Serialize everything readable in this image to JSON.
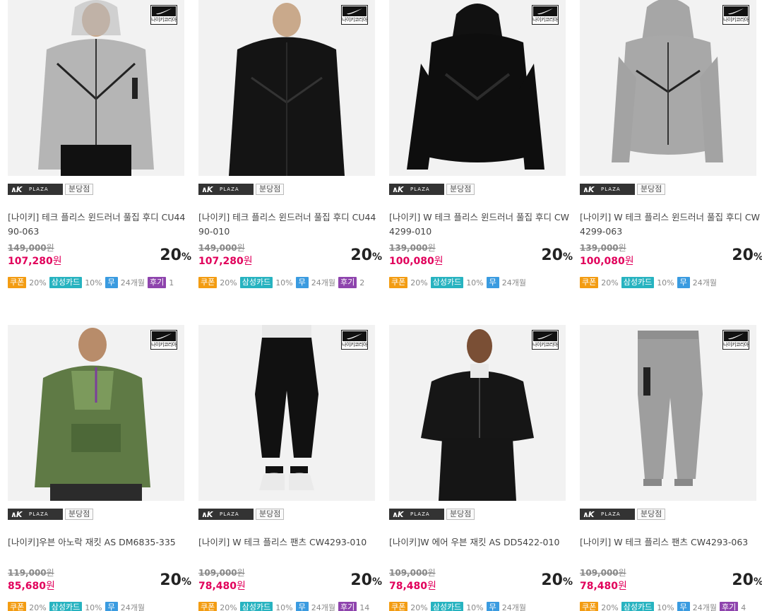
{
  "badge_text": "나이키코리아",
  "store_logo": "PLAZA",
  "products": [
    {
      "title": "[나이키] 테크 플리스 윈드러너 풀집 후디 CU4490-063",
      "original_price": "149,000",
      "sale_price": "107,280",
      "won": "원",
      "discount": "20",
      "pct": "%",
      "branch": "분당점",
      "coupon_label": "쿠폰",
      "coupon_value": "20%",
      "card_label": "삼성카드",
      "card_value": "10%",
      "free_label": "무",
      "months": "24개월",
      "review_label": "후기",
      "review_count": "1",
      "image": "gray-hoodie-man"
    },
    {
      "title": "[나이키] 테크 플리스 윈드러너 풀집 후디 CU4490-010",
      "original_price": "149,000",
      "sale_price": "107,280",
      "won": "원",
      "discount": "20",
      "pct": "%",
      "branch": "분당점",
      "coupon_label": "쿠폰",
      "coupon_value": "20%",
      "card_label": "삼성카드",
      "card_value": "10%",
      "free_label": "무",
      "months": "24개월",
      "review_label": "후기",
      "review_count": "2",
      "image": "black-hoodie-man"
    },
    {
      "title": "[나이키] W 테크 플리스 윈드러너 풀집 후디 CW4299-010",
      "original_price": "139,000",
      "sale_price": "100,080",
      "won": "원",
      "discount": "20",
      "pct": "%",
      "branch": "분당점",
      "coupon_label": "쿠폰",
      "coupon_value": "20%",
      "card_label": "삼성카드",
      "card_value": "10%",
      "free_label": "무",
      "months": "24개월",
      "review_label": "",
      "review_count": "",
      "image": "black-hoodie-product"
    },
    {
      "title": "[나이키] W 테크 플리스 윈드러너 풀집 후디 CW4299-063",
      "original_price": "139,000",
      "sale_price": "100,080",
      "won": "원",
      "discount": "20",
      "pct": "%",
      "branch": "분당점",
      "coupon_label": "쿠폰",
      "coupon_value": "20%",
      "card_label": "삼성카드",
      "card_value": "10%",
      "free_label": "무",
      "months": "24개월",
      "review_label": "",
      "review_count": "",
      "image": "gray-hoodie-product"
    },
    {
      "title": "[나이키]우븐 아노락 재킷 AS DM6835-335",
      "original_price": "119,000",
      "sale_price": "85,680",
      "won": "원",
      "discount": "20",
      "pct": "%",
      "branch": "분당점",
      "coupon_label": "쿠폰",
      "coupon_value": "20%",
      "card_label": "삼성카드",
      "card_value": "10%",
      "free_label": "무",
      "months": "24개월",
      "review_label": "",
      "review_count": "",
      "image": "green-anorak-man"
    },
    {
      "title": "[나이키] W 테크 플리스 팬츠 CW4293-010",
      "original_price": "109,000",
      "sale_price": "78,480",
      "won": "원",
      "discount": "20",
      "pct": "%",
      "branch": "분당점",
      "coupon_label": "쿠폰",
      "coupon_value": "20%",
      "card_label": "삼성카드",
      "card_value": "10%",
      "free_label": "무",
      "months": "24개월",
      "review_label": "후기",
      "review_count": "14",
      "image": "black-pants-woman"
    },
    {
      "title": "[나이키]W 에어 우븐 재킷 AS DD5422-010",
      "original_price": "109,000",
      "sale_price": "78,480",
      "won": "원",
      "discount": "20",
      "pct": "%",
      "branch": "분당점",
      "coupon_label": "쿠폰",
      "coupon_value": "20%",
      "card_label": "삼성카드",
      "card_value": "10%",
      "free_label": "무",
      "months": "24개월",
      "review_label": "",
      "review_count": "",
      "image": "black-jacket-woman"
    },
    {
      "title": "[나이키] W 테크 플리스 팬츠 CW4293-063",
      "original_price": "109,000",
      "sale_price": "78,480",
      "won": "원",
      "discount": "20",
      "pct": "%",
      "branch": "분당점",
      "coupon_label": "쿠폰",
      "coupon_value": "20%",
      "card_label": "삼성카드",
      "card_value": "10%",
      "free_label": "무",
      "months": "24개월",
      "review_label": "후기",
      "review_count": "4",
      "image": "gray-pants-product"
    }
  ],
  "colors": {
    "sale_price": "#e1005b",
    "coupon": "#f39c12",
    "card": "#27b3c0",
    "free": "#3a9be0",
    "review": "#8e44ad"
  }
}
